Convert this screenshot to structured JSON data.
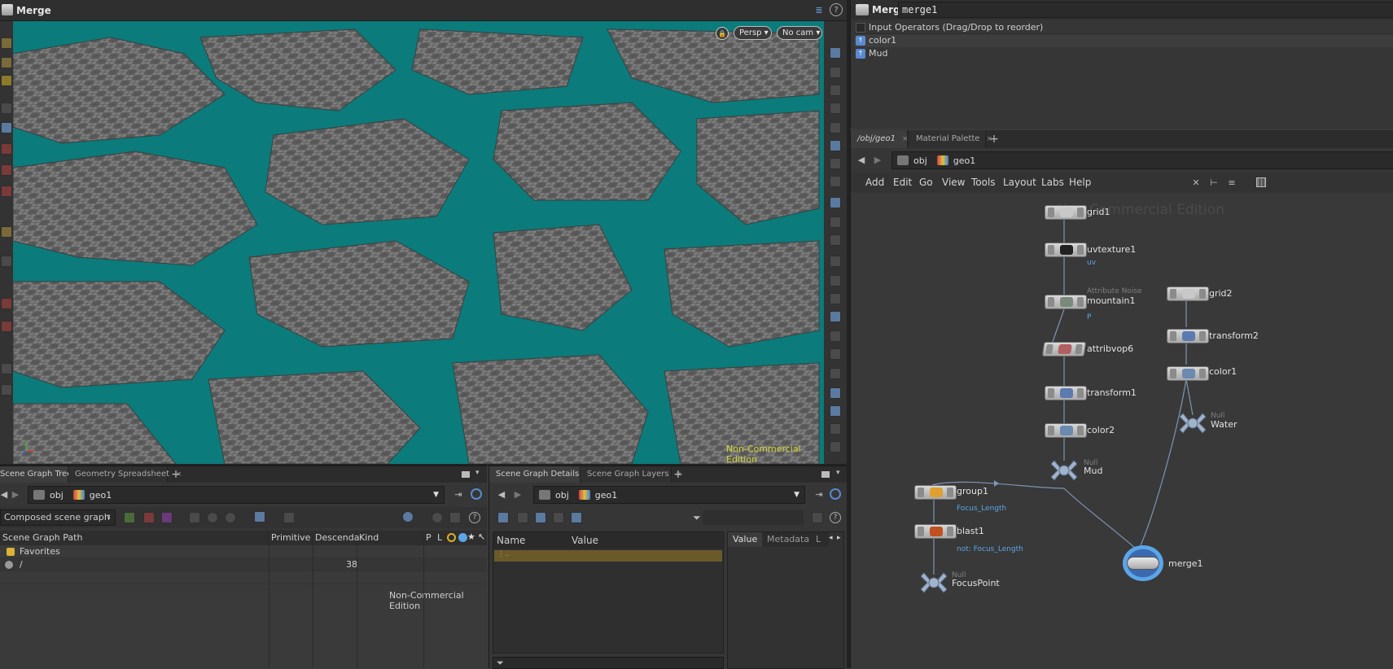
{
  "viewer": {
    "title": "Merge",
    "persp_label": "Persp",
    "cam_label": "No cam",
    "watermark": "Non-Commercial Edition",
    "help_icon": "?"
  },
  "params": {
    "type": "Merge",
    "node_name": "merge1",
    "inputs_header": "Input Operators (Drag/Drop to reorder)",
    "inputs": [
      "color1",
      "Mud"
    ]
  },
  "network": {
    "tabs": [
      {
        "label": "/obj/geo1"
      },
      {
        "label": "Material Palette"
      }
    ],
    "path": [
      "obj",
      "geo1"
    ],
    "menu": [
      "Add",
      "Edit",
      "Go",
      "View",
      "Tools",
      "Layout",
      "Labs",
      "Help"
    ],
    "watermark": "Non-Commercial Edition",
    "nodes": {
      "grid1": {
        "name": "grid1"
      },
      "uvtexture1": {
        "name": "uvtexture1",
        "sub": "uv"
      },
      "mountain1": {
        "name": "mountain1",
        "type": "Attribute Noise",
        "sub": "P"
      },
      "attribvop6": {
        "name": "attribvop6"
      },
      "transform1": {
        "name": "transform1"
      },
      "color2": {
        "name": "color2"
      },
      "mud": {
        "name": "Mud",
        "type": "Null"
      },
      "group1": {
        "name": "group1",
        "sub": "Focus_Length"
      },
      "blast1": {
        "name": "blast1",
        "sub": "not: Focus_Length"
      },
      "focuspoint": {
        "name": "FocusPoint",
        "type": "Null"
      },
      "grid2": {
        "name": "grid2"
      },
      "transform2": {
        "name": "transform2"
      },
      "color1": {
        "name": "color1"
      },
      "water": {
        "name": "Water",
        "type": "Null"
      },
      "merge1": {
        "name": "merge1"
      }
    }
  },
  "scene_graph_tree": {
    "tabs": [
      {
        "label": "Scene Graph Tree"
      },
      {
        "label": "Geometry Spreadsheet"
      }
    ],
    "path": [
      "obj",
      "geo1"
    ],
    "mode_label": "Composed scene graph",
    "columns": [
      "Scene Graph Path",
      "Primitive T",
      "Descenda",
      "Kind",
      "P",
      "L"
    ],
    "rows": [
      {
        "path": "Favorites",
        "descendants": ""
      },
      {
        "path": "/",
        "descendants": "38"
      }
    ],
    "watermark": "Non-Commercial Edition"
  },
  "scene_graph_details": {
    "tabs": [
      {
        "label": "Scene Graph Details"
      },
      {
        "label": "Scene Graph Layers"
      }
    ],
    "path": [
      "obj",
      "geo1"
    ],
    "columns": [
      "Name",
      "Value"
    ],
    "side_tabs": [
      "Value",
      "Metadata",
      "L"
    ]
  },
  "colors": {
    "teal": "#0e8080",
    "selected": "#5aa6e8",
    "wire": "#4f82bf",
    "watermark": "#d6d63a"
  }
}
